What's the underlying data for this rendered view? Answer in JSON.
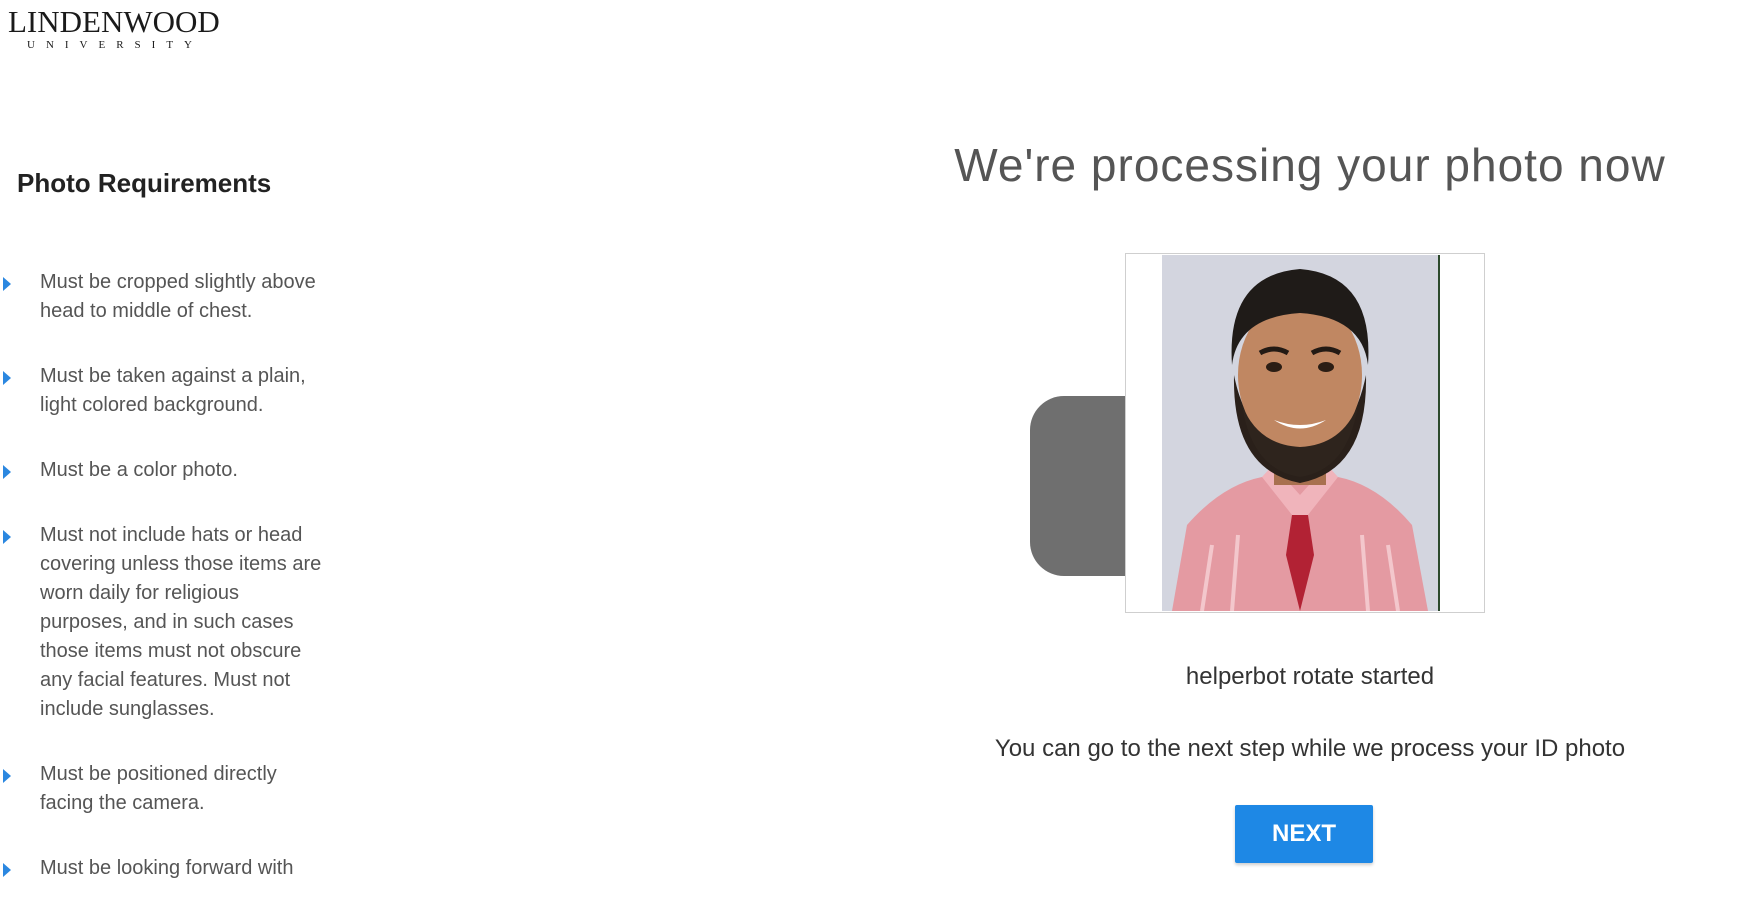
{
  "header": {
    "logo_main": "LINDENWOOD",
    "logo_sub": "UNIVERSITY"
  },
  "sidebar": {
    "title": "Photo Requirements",
    "items": [
      "Must be cropped slightly above head to middle of chest.",
      "Must be taken against a plain, light colored background.",
      "Must be a color photo.",
      "Must not include hats or head covering unless those items are worn daily for religious purposes, and in such cases those items must not obscure any facial features. Must not include sunglasses.",
      "Must be positioned directly facing the camera.",
      "Must be looking forward with"
    ]
  },
  "main": {
    "title": "We're processing your photo now",
    "status": "helperbot rotate started",
    "info": "You can go to the next step while we process your ID photo",
    "next_label": "NEXT"
  },
  "icons": {
    "rotate": "rotate-icon",
    "bullet": "chevron-right-icon"
  },
  "colors": {
    "accent": "#1e88e5",
    "bullet": "#2b87e0"
  }
}
